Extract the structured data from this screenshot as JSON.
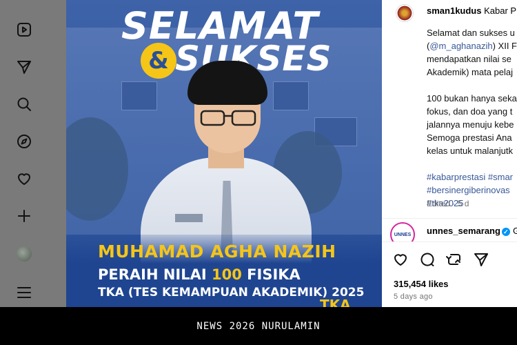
{
  "sidebar": {
    "icons": [
      "reels-icon",
      "send-icon",
      "search-icon",
      "explore-icon",
      "heart-icon",
      "plus-icon",
      "profile-avatar",
      "menu-icon"
    ]
  },
  "post_image": {
    "headline_line1": "SELAMAT",
    "headline_amp": "&",
    "headline_line2": "SUKSES",
    "student_name": "MUHAMAD AGHA NAZIH",
    "award_prefix": "PERAIH NILAI ",
    "award_score": "100",
    "award_subject": " FISIKA",
    "exam_line": "TKA (TES KEMAMPUAN AKADEMIK) 2025",
    "corner_text": "TKA"
  },
  "post": {
    "author_handle": "sman1kudus",
    "author_title": "Kabar P",
    "caption_lines": [
      "Selamat dan sukses u",
      "(@m_aghanazih) XII F",
      "mendapatkan nilai se",
      "Akademik) mata pelaj"
    ],
    "caption_lines_2": [
      "100 bukan hanya seka",
      "fokus, dan doa yang t",
      "jalannya menuju kebe",
      "Semoga prestasi Ana",
      "kelas untuk malanjutk"
    ],
    "hashtags": [
      "#kabarprestasi #smar",
      "#bersinergiberinovas",
      "#tka2025"
    ],
    "edited": "Edited · 5 d"
  },
  "comment": {
    "handle": "unnes_semarang",
    "avatar_text": "UNNES",
    "more": "G"
  },
  "stats": {
    "likes": "315,454 likes",
    "time_ago": "5 days ago"
  },
  "footer": {
    "text": "NEWS 2026 NURULAMIN"
  }
}
